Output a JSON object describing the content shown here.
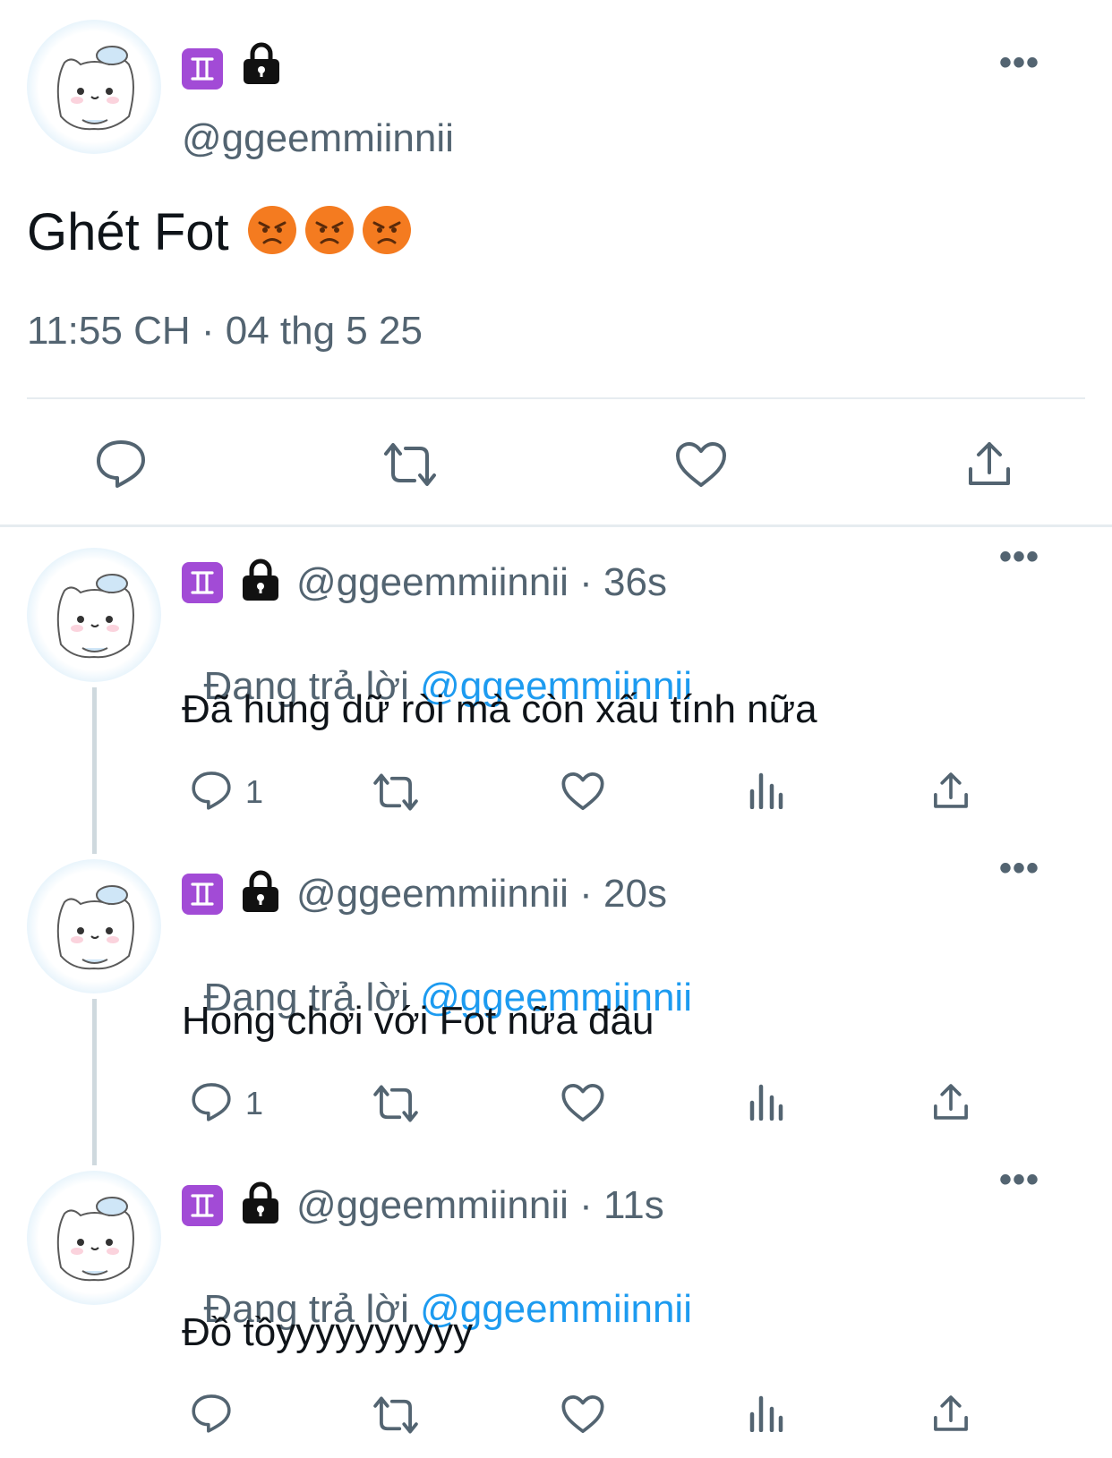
{
  "main_tweet": {
    "name_emoji": "gemini-sign",
    "handle": "@ggeemmiinnii",
    "text": "Ghét Fot",
    "emojis": [
      "angry-face",
      "angry-face",
      "angry-face"
    ],
    "timestamp": "11:55 CH · 04 thg 5 25"
  },
  "replies": [
    {
      "handle": "@ggeemmiinnii",
      "sep": " · ",
      "time": "36s",
      "replying_prefix": "Đang trả lời ",
      "replying_to": "@ggeemmiinnii",
      "text": "Đã hung dữ ròi mà còn xấu tính nữa",
      "reply_count": "1"
    },
    {
      "handle": "@ggeemmiinnii",
      "sep": " · ",
      "time": "20s",
      "replying_prefix": "Đang trả lời ",
      "replying_to": "@ggeemmiinnii",
      "text": "Hong chơi với Fot nữa đâu",
      "reply_count": "1"
    },
    {
      "handle": "@ggeemmiinnii",
      "sep": " · ",
      "time": "11s",
      "replying_prefix": "Đang trả lời ",
      "replying_to": "@ggeemmiinnii",
      "text": "Đồ tồyyyyyyyyyy",
      "reply_count": ""
    }
  ],
  "colors": {
    "accent": "#1d9bf0",
    "muted": "#536471",
    "gemini": "#a24bd6",
    "angry": "#f47b20"
  }
}
